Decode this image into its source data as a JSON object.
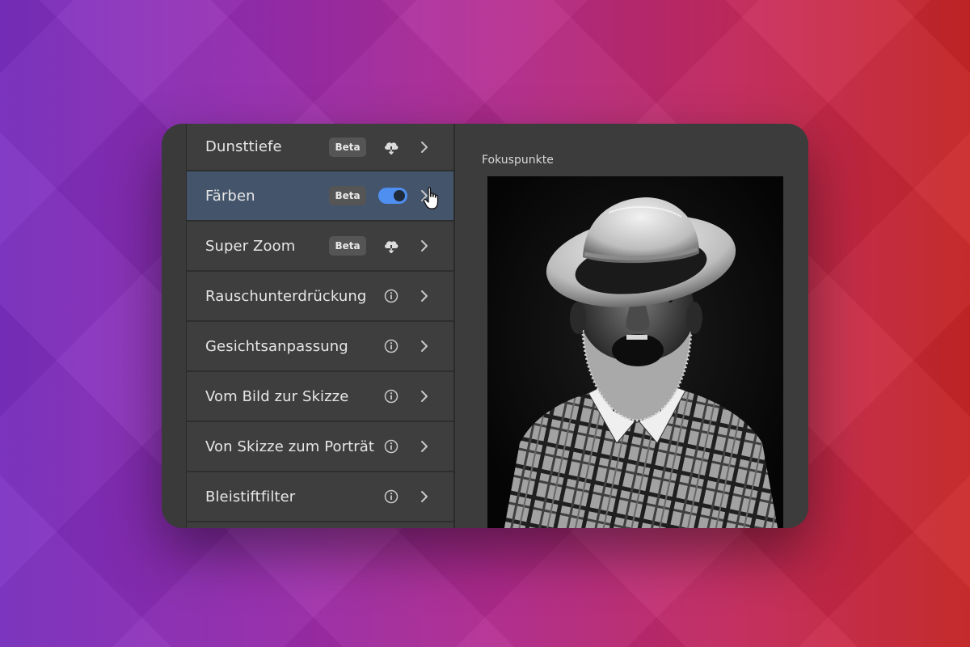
{
  "panel": {
    "title": "Fokuspunkte"
  },
  "filters": [
    {
      "label": "Dunsttiefe",
      "badge": "Beta",
      "icon": "cloud-download-icon"
    },
    {
      "label": "Färben",
      "badge": "Beta",
      "toggle_on": true
    },
    {
      "label": "Super Zoom",
      "badge": "Beta",
      "icon": "cloud-download-icon"
    },
    {
      "label": "Rauschunterdrückung",
      "icon": "info-icon"
    },
    {
      "label": "Gesichtsanpassung",
      "icon": "info-icon"
    },
    {
      "label": "Vom Bild zur Skizze",
      "icon": "info-icon"
    },
    {
      "label": "Von Skizze zum Porträt",
      "icon": "info-icon"
    },
    {
      "label": "Bleistiftfilter",
      "icon": "info-icon"
    }
  ],
  "colors": {
    "selected_row": "#43546b",
    "toggle_on": "#4f8ff0",
    "panel_bg": "#3c3c3c"
  }
}
